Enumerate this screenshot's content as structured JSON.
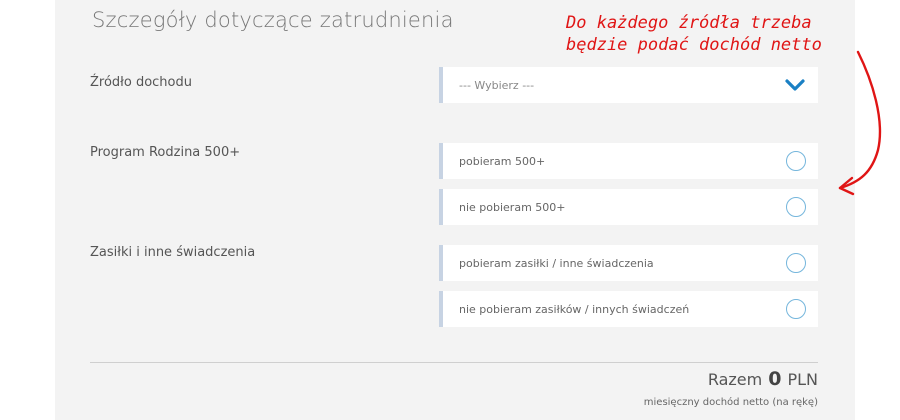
{
  "section": {
    "title": "Szczegóły dotyczące zatrudnienia"
  },
  "income_source": {
    "label": "Źródło dochodu",
    "select_value": "--- Wybierz ---"
  },
  "program_500": {
    "label": "Program Rodzina 500+",
    "options": [
      {
        "text": "pobieram 500+"
      },
      {
        "text": "nie pobieram 500+"
      }
    ]
  },
  "benefits": {
    "label": "Zasiłki i inne świadczenia",
    "options": [
      {
        "text": "pobieram zasiłki / inne świadczenia"
      },
      {
        "text": "nie pobieram zasiłków / innych świadczeń"
      }
    ]
  },
  "summary": {
    "total_label": "Razem",
    "total_value": "0",
    "currency": "PLN",
    "subtitle": "miesięczny dochód netto (na rękę)"
  },
  "annotation": {
    "line1": "Do każdego źródła trzeba",
    "line2": "będzie podać dochód netto",
    "color": "#e01515"
  },
  "colors": {
    "accent": "#1a80c4",
    "radio_border": "#75b6dc",
    "field_marker": "#c7d3e3",
    "panel_bg": "#f3f3f3"
  }
}
